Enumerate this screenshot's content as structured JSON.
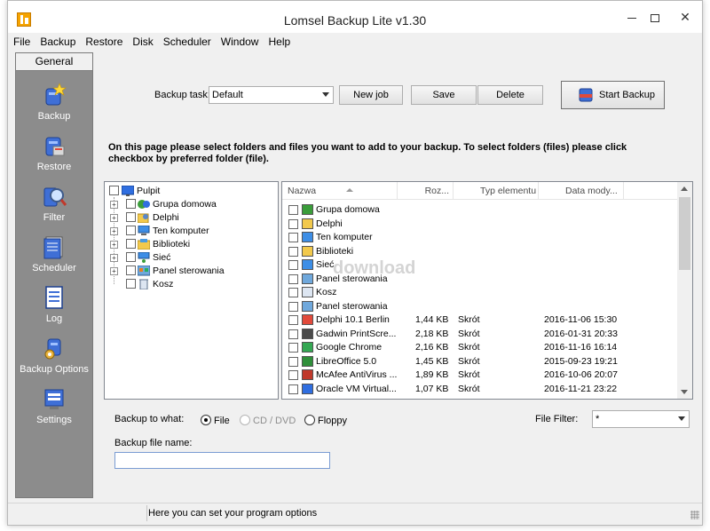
{
  "window": {
    "title": "Lomsel Backup Lite v1.30"
  },
  "menu": [
    "File",
    "Backup",
    "Restore",
    "Disk",
    "Scheduler",
    "Window",
    "Help"
  ],
  "sidebar": {
    "header": "General",
    "items": [
      {
        "label": "Backup",
        "icon": "backup-icon"
      },
      {
        "label": "Restore",
        "icon": "restore-icon"
      },
      {
        "label": "Filter",
        "icon": "filter-icon"
      },
      {
        "label": "Scheduler",
        "icon": "scheduler-icon"
      },
      {
        "label": "Log",
        "icon": "log-icon"
      },
      {
        "label": "Backup Options",
        "icon": "backup-options-icon"
      },
      {
        "label": "Settings",
        "icon": "settings-icon"
      }
    ]
  },
  "toolbar": {
    "task_label": "Backup task:",
    "task_value": "Default",
    "new_job": "New job",
    "save": "Save",
    "delete": "Delete",
    "start_backup": "Start Backup"
  },
  "instructions": "On this page please select folders and files you want to add to your backup. To select folders (files) please click checkbox by preferred folder (file).",
  "tree": [
    {
      "label": "Pulpit",
      "expandable": false,
      "level": 0
    },
    {
      "label": "Grupa domowa",
      "expandable": true,
      "level": 1
    },
    {
      "label": "Delphi",
      "expandable": true,
      "level": 1
    },
    {
      "label": "Ten komputer",
      "expandable": true,
      "level": 1
    },
    {
      "label": "Biblioteki",
      "expandable": true,
      "level": 1
    },
    {
      "label": "Sieć",
      "expandable": true,
      "level": 1
    },
    {
      "label": "Panel sterowania",
      "expandable": true,
      "level": 1
    },
    {
      "label": "Kosz",
      "expandable": false,
      "level": 1
    }
  ],
  "file_list": {
    "columns": [
      "Nazwa",
      "Roz...",
      "Typ elementu",
      "Data mody..."
    ],
    "rows": [
      {
        "name": "Grupa domowa",
        "size": "",
        "type": "",
        "date": ""
      },
      {
        "name": "Delphi",
        "size": "",
        "type": "",
        "date": ""
      },
      {
        "name": "Ten komputer",
        "size": "",
        "type": "",
        "date": ""
      },
      {
        "name": "Biblioteki",
        "size": "",
        "type": "",
        "date": ""
      },
      {
        "name": "Sieć",
        "size": "",
        "type": "",
        "date": ""
      },
      {
        "name": "Panel sterowania",
        "size": "",
        "type": "",
        "date": ""
      },
      {
        "name": "Kosz",
        "size": "",
        "type": "",
        "date": ""
      },
      {
        "name": "Panel sterowania",
        "size": "",
        "type": "",
        "date": ""
      },
      {
        "name": "Delphi 10.1 Berlin",
        "size": "1,44 KB",
        "type": "Skrót",
        "date": "2016-11-06 15:30"
      },
      {
        "name": "Gadwin PrintScre...",
        "size": "2,18 KB",
        "type": "Skrót",
        "date": "2016-01-31 20:33"
      },
      {
        "name": "Google Chrome",
        "size": "2,16 KB",
        "type": "Skrót",
        "date": "2016-11-16 16:14"
      },
      {
        "name": "LibreOffice 5.0",
        "size": "1,45 KB",
        "type": "Skrót",
        "date": "2015-09-23 19:21"
      },
      {
        "name": "McAfee AntiVirus ...",
        "size": "1,89 KB",
        "type": "Skrót",
        "date": "2016-10-06 20:07"
      },
      {
        "name": "Oracle VM Virtual...",
        "size": "1,07 KB",
        "type": "Skrót",
        "date": "2016-11-21 23:22"
      }
    ]
  },
  "watermark": "download",
  "bottom": {
    "backup_to_label": "Backup to what:",
    "options": [
      "File",
      "CD / DVD",
      "Floppy"
    ],
    "file_filter_label": "File Filter:",
    "file_filter_value": "*",
    "backup_file_name_label": "Backup file name:",
    "backup_file_name_value": ""
  },
  "status": {
    "text": "Here you can set your program options"
  }
}
